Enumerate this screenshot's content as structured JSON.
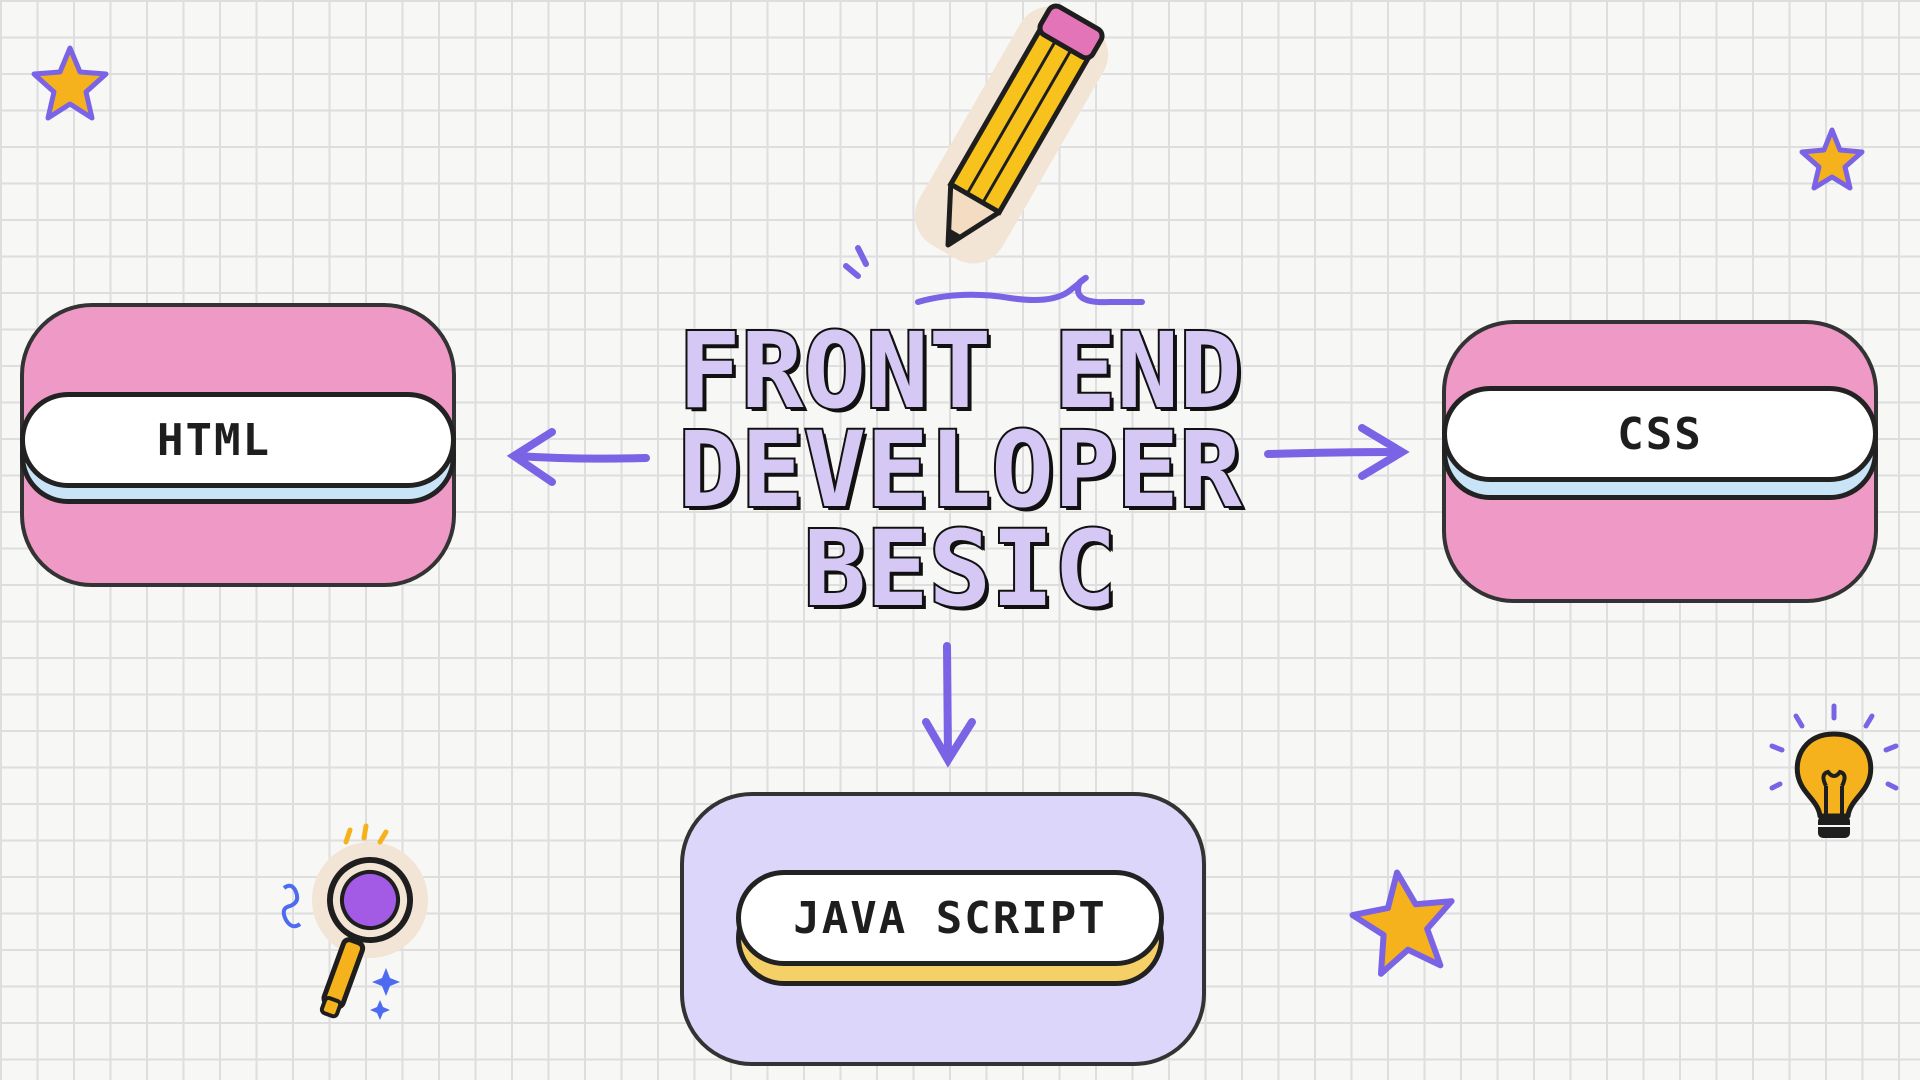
{
  "title": {
    "line1": "FRONT END",
    "line2": "DEVELOPER",
    "line3": "BESIC"
  },
  "nodes": {
    "html": {
      "label": "HTML"
    },
    "css": {
      "label": "CSS"
    },
    "javascript": {
      "label": "JAVA SCRIPT"
    }
  },
  "colors": {
    "grid_background": "#f7f7f5",
    "grid_lines": "#dedede",
    "pink_box": "#ef99c6",
    "lavender_box": "#ddd6fb",
    "title_fill": "#d6c8f5",
    "arrow": "#7b63e6",
    "star": "#f6b21c",
    "html_pill_shadow": "#c9e3f7",
    "css_pill_shadow": "#c9e3f7",
    "js_pill_shadow": "#f4d066"
  },
  "icons": [
    "pencil-icon",
    "magnifier-icon",
    "lightbulb-icon",
    "star-icon"
  ]
}
